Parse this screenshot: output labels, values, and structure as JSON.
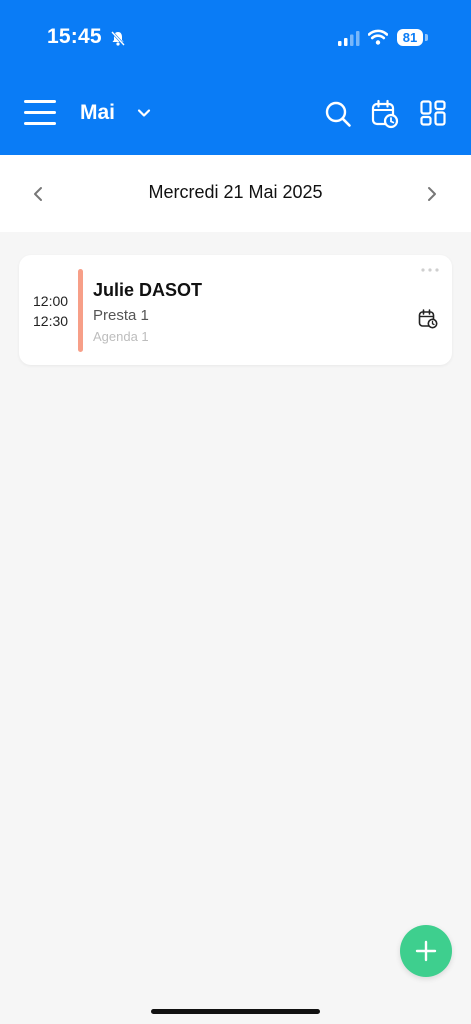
{
  "status_bar": {
    "time": "15:45",
    "battery": "81"
  },
  "header": {
    "month": "Mai"
  },
  "date_nav": {
    "date": "Mercredi 21 Mai 2025"
  },
  "appointments": [
    {
      "start": "12:00",
      "end": "12:30",
      "client": "Julie DASOT",
      "service": "Presta 1",
      "agenda": "Agenda 1",
      "color": "#f79f88"
    }
  ],
  "colors": {
    "header_bg": "#0a7cf6",
    "fab": "#3ecf8e",
    "page_bg": "#f6f6f6"
  },
  "icons": {
    "menu": "hamburger-icon",
    "month_dropdown": "chevron-down-icon",
    "search": "search-icon",
    "calendar_clock": "calendar-clock-icon",
    "view": "grid-icon",
    "prev": "chevron-left-icon",
    "next": "chevron-right-icon",
    "more": "more-dots-icon",
    "add": "plus-icon"
  }
}
